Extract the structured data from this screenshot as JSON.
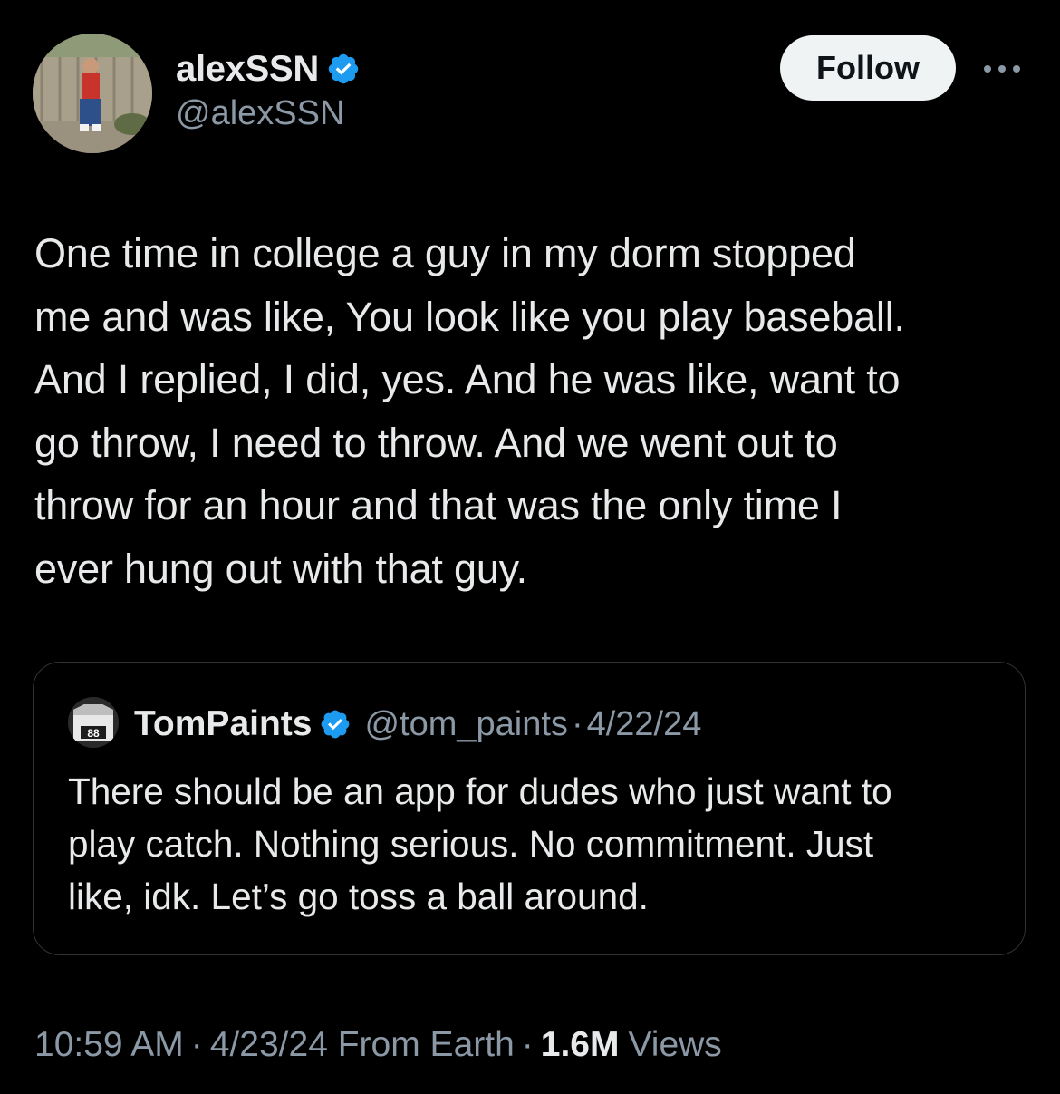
{
  "author": {
    "display_name": "alexSSN",
    "handle": "@alexSSN",
    "verified_icon": "verified-badge-icon",
    "avatar_icon": "profile-photo-avatar"
  },
  "actions": {
    "follow_label": "Follow",
    "more_icon": "more-options-icon"
  },
  "tweet": {
    "text_lines": [
      "One time in college a guy in my dorm stopped",
      "me and was like, You look like you play baseball.",
      "And I replied, I did, yes. And he was like, want to",
      "go throw, I need to throw. And we went out to",
      "throw for an hour and that was the only time I",
      "ever hung out with that guy."
    ]
  },
  "quoted_tweet": {
    "display_name": "TomPaints",
    "handle": "@tom_paints",
    "separator": "·",
    "date": "4/22/24",
    "avatar_icon": "jersey-88-avatar",
    "text_lines": [
      "There should be an app for dudes who just want to",
      "play catch. Nothing serious. No commitment. Just",
      "like, idk. Let’s go toss a ball around."
    ]
  },
  "meta": {
    "time": "10:59 AM",
    "separator": "·",
    "date_location": "4/23/24 From Earth",
    "views_count": "1.6M",
    "views_label": "Views"
  },
  "colors": {
    "background": "#000000",
    "text_primary": "#e7e9ea",
    "text_secondary": "#8b98a5",
    "verified_blue": "#1d9bf0",
    "border": "#2f3336",
    "follow_bg": "#eff3f4"
  }
}
